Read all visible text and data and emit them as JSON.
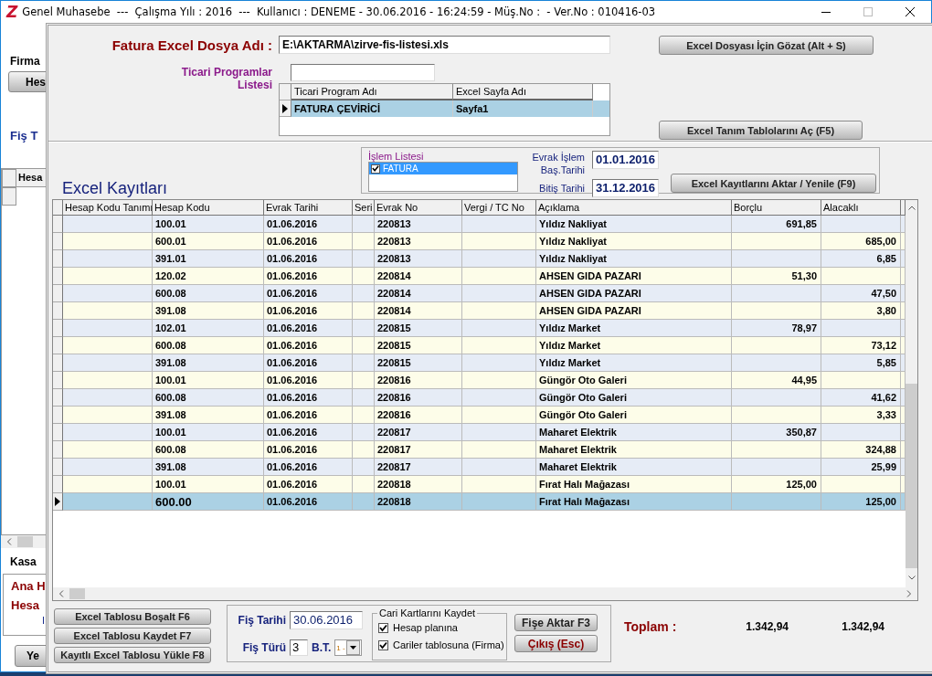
{
  "window": {
    "logo": "Z",
    "title": "Genel Muhasebe  ---  Çalışma Yılı : 2016  ---  Kullanıcı : DENEME - 30.06.2016 - 16:24:59 - Müş.No :  - Ver.No : 010416-03"
  },
  "background_window": {
    "company_label": "Firma",
    "account_button": "Hes",
    "voucher_label": "Fiş T",
    "grid_header": "Hesa",
    "cash_label": "Kasa",
    "panel_lines": [
      "Ana H",
      "Hesa"
    ],
    "panel_mark": "I",
    "new_button": "Ye"
  },
  "dialog": {
    "file_label": "Fatura Excel Dosya Adı :",
    "file_path": "E:\\AKTARMA\\zirve-fis-listesi.xls",
    "browse_button": "Excel Dosyası İçin Gözat (Alt + S)",
    "programs_label": "Ticari Programlar Listesi",
    "programs_table": {
      "columns": [
        "Ticari Program Adı",
        "Excel Sayfa Adı"
      ],
      "rows": [
        {
          "name": "FATURA ÇEVİRİCİ",
          "sheet": "Sayfa1",
          "selected": true
        }
      ]
    },
    "definitions_button": "Excel Tanım Tablolarını Aç (F5)",
    "records_title": "Excel Kayıtları",
    "operation_list": {
      "title": "İşlem Listesi",
      "items": [
        {
          "label": "FATURA",
          "checked": true,
          "selected": true
        }
      ]
    },
    "start_label": "Evrak İşlem Baş.Tarihi",
    "start_date": "01.01.2016",
    "end_label": "Bitiş Tarihi",
    "end_date": "31.12.2016",
    "import_button": "Excel Kayıtlarını Aktar / Yenile (F9)",
    "records_table": {
      "columns": [
        "Hesap Kodu Tanımı",
        "Hesap Kodu",
        "Evrak Tarihi",
        "Seri",
        "Evrak No",
        "Vergi / TC No",
        "Açıklama",
        "Borçlu",
        "Alacaklı"
      ],
      "rows": [
        {
          "code": "100.01",
          "date": "01.06.2016",
          "doc_no": "220813",
          "description": "Yıldız Nakliyat",
          "debit": "691,85",
          "selected": false
        },
        {
          "code": "600.01",
          "date": "01.06.2016",
          "doc_no": "220813",
          "description": "Yıldız Nakliyat",
          "credit": "685,00",
          "selected": false
        },
        {
          "code": "391.01",
          "date": "01.06.2016",
          "doc_no": "220813",
          "description": "Yıldız Nakliyat",
          "credit": "6,85",
          "selected": false
        },
        {
          "code": "120.02",
          "date": "01.06.2016",
          "doc_no": "220814",
          "description": "AHSEN GIDA PAZARI",
          "debit": "51,30",
          "selected": false
        },
        {
          "code": "600.08",
          "date": "01.06.2016",
          "doc_no": "220814",
          "description": "AHSEN GIDA PAZARI",
          "credit": "47,50",
          "selected": false
        },
        {
          "code": "391.08",
          "date": "01.06.2016",
          "doc_no": "220814",
          "description": "AHSEN GIDA PAZARI",
          "credit": "3,80",
          "selected": false
        },
        {
          "code": "102.01",
          "date": "01.06.2016",
          "doc_no": "220815",
          "description": "Yıldız Market",
          "debit": "78,97",
          "selected": false
        },
        {
          "code": "600.08",
          "date": "01.06.2016",
          "doc_no": "220815",
          "description": "Yıldız Market",
          "credit": "73,12",
          "selected": false
        },
        {
          "code": "391.08",
          "date": "01.06.2016",
          "doc_no": "220815",
          "description": "Yıldız Market",
          "credit": "5,85",
          "selected": false
        },
        {
          "code": "100.01",
          "date": "01.06.2016",
          "doc_no": "220816",
          "description": "Güngör Oto Galeri",
          "debit": "44,95",
          "selected": false
        },
        {
          "code": "600.08",
          "date": "01.06.2016",
          "doc_no": "220816",
          "description": "Güngör Oto Galeri",
          "credit": "41,62",
          "selected": false
        },
        {
          "code": "391.08",
          "date": "01.06.2016",
          "doc_no": "220816",
          "description": "Güngör Oto Galeri",
          "credit": "3,33",
          "selected": false
        },
        {
          "code": "100.01",
          "date": "01.06.2016",
          "doc_no": "220817",
          "description": "Maharet Elektrik",
          "debit": "350,87",
          "selected": false
        },
        {
          "code": "600.08",
          "date": "01.06.2016",
          "doc_no": "220817",
          "description": "Maharet Elektrik",
          "credit": "324,88",
          "selected": false
        },
        {
          "code": "391.08",
          "date": "01.06.2016",
          "doc_no": "220817",
          "description": "Maharet Elektrik",
          "credit": "25,99",
          "selected": false
        },
        {
          "code": "100.01",
          "date": "01.06.2016",
          "doc_no": "220818",
          "description": "Fırat Halı Mağazası",
          "debit": "125,00",
          "selected": false
        },
        {
          "code": "600.00",
          "date": "01.06.2016",
          "doc_no": "220818",
          "description": "Fırat Halı Mağazası",
          "credit": "125,00",
          "selected": true
        }
      ]
    },
    "clear_button": "Excel Tablosu Boşalt F6",
    "save_button": "Excel Tablosu Kaydet F7",
    "load_button": "Kayıtlı Excel Tablosu Yükle F8",
    "voucher_date_label": "Fiş Tarihi",
    "voucher_date": "30.06.2016",
    "voucher_type_label": "Fiş Türü",
    "voucher_type": "3",
    "bt_label": "B.T.",
    "bt_value": "1 -",
    "save_cards": {
      "title": "Cari Kartlarını Kaydet",
      "options": [
        {
          "label": "Hesap planına",
          "checked": true
        },
        {
          "label": "Cariler tablosuna (Firma)",
          "checked": true
        }
      ]
    },
    "transfer_button": "Fişe Aktar F3",
    "exit_button": "Çıkış (Esc)",
    "total_label": "Toplam :",
    "total_debit": "1.342,94",
    "total_credit": "1.342,94"
  }
}
